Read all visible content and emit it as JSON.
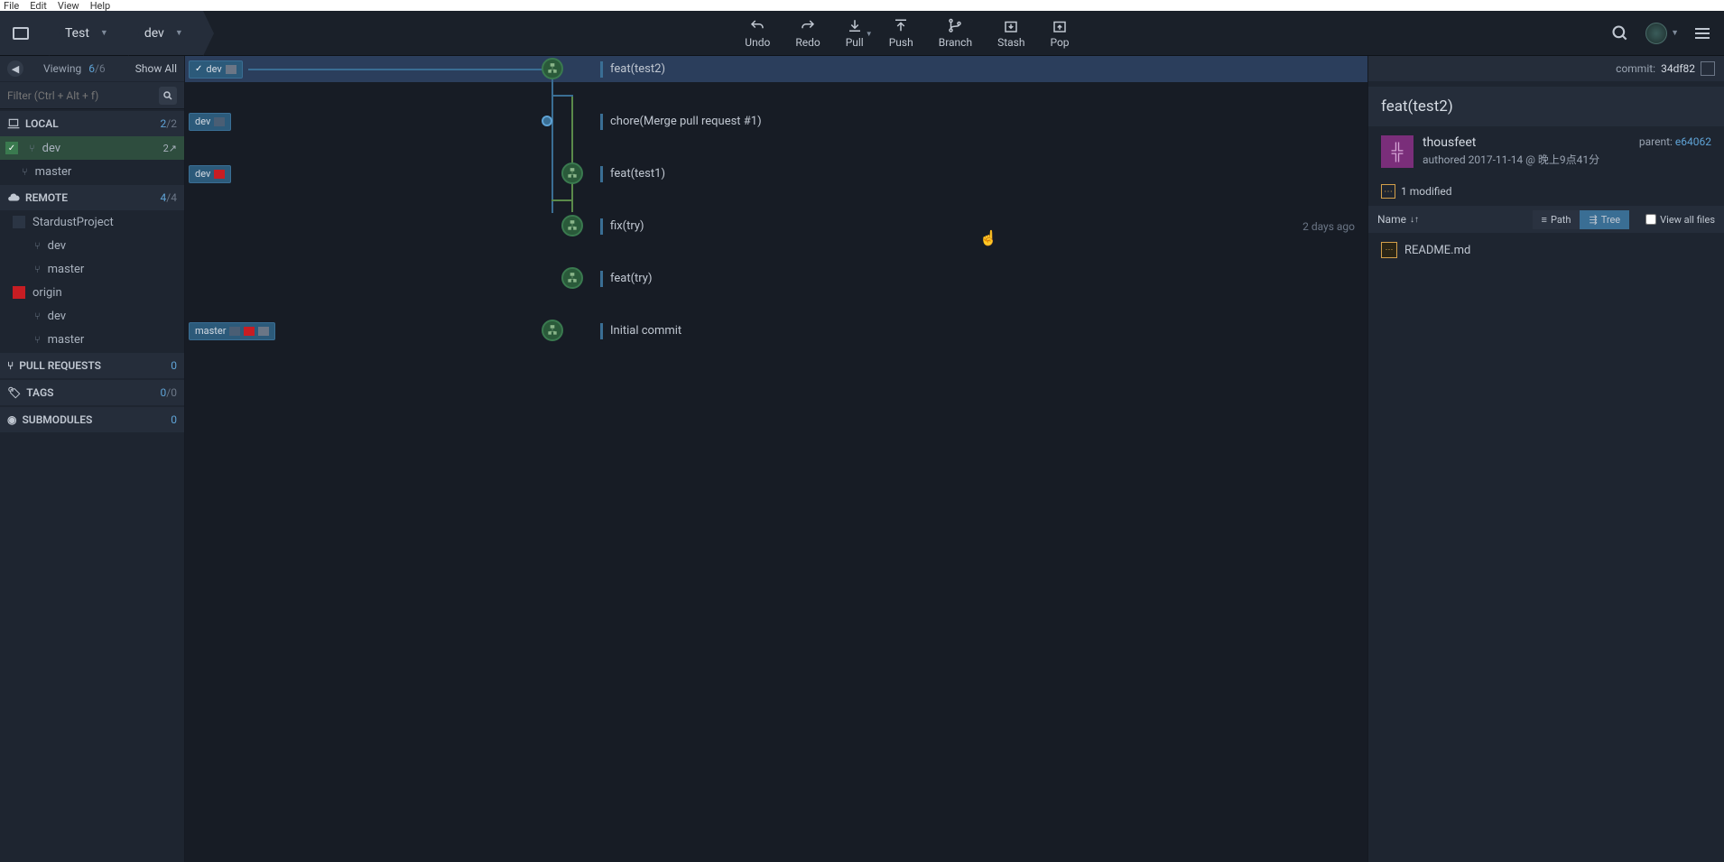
{
  "menubar": [
    "File",
    "Edit",
    "View",
    "Help"
  ],
  "breadcrumbs": {
    "repo": "Test",
    "branch": "dev"
  },
  "toolbar_buttons": [
    {
      "id": "undo",
      "label": "Undo"
    },
    {
      "id": "redo",
      "label": "Redo"
    },
    {
      "id": "pull",
      "label": "Pull",
      "caret": true
    },
    {
      "id": "push",
      "label": "Push"
    },
    {
      "id": "branch",
      "label": "Branch"
    },
    {
      "id": "stash",
      "label": "Stash"
    },
    {
      "id": "pop",
      "label": "Pop"
    }
  ],
  "sidebar": {
    "viewing_label": "Viewing",
    "viewing_count": "6",
    "viewing_total": "/6",
    "show_all": "Show All",
    "filter_placeholder": "Filter (Ctrl + Alt + f)",
    "sections": {
      "local": {
        "label": "LOCAL",
        "count": "2",
        "total": "/2",
        "items": [
          {
            "name": "dev",
            "active": true,
            "ahead": "2↗"
          },
          {
            "name": "master"
          }
        ]
      },
      "remote": {
        "label": "REMOTE",
        "count": "4",
        "total": "/4",
        "repos": [
          {
            "name": "StardustProject",
            "icon": "sp",
            "branches": [
              "dev",
              "master"
            ]
          },
          {
            "name": "origin",
            "icon": "gitee",
            "branches": [
              "dev",
              "master"
            ]
          }
        ]
      },
      "pull_requests": {
        "label": "PULL REQUESTS",
        "count": "0"
      },
      "tags": {
        "label": "TAGS",
        "count": "0",
        "total": "/0"
      },
      "submodules": {
        "label": "SUBMODULES",
        "count": "0"
      }
    }
  },
  "commits": [
    {
      "refs": [
        {
          "name": "dev",
          "current": true,
          "icons": [
            "laptop"
          ]
        }
      ],
      "msg": "feat(test2)",
      "selected": true,
      "lane": 0
    },
    {
      "refs": [
        {
          "name": "dev",
          "icons": [
            "sp"
          ]
        }
      ],
      "msg": "chore(Merge pull request #1)",
      "merge": true,
      "lane": 0
    },
    {
      "refs": [
        {
          "name": "dev",
          "icons": [
            "gitee"
          ]
        }
      ],
      "msg": "feat(test1)",
      "lane": 1
    },
    {
      "refs": [],
      "msg": "fix(try)",
      "time": "2 days ago",
      "lane": 1
    },
    {
      "refs": [],
      "msg": "feat(try)",
      "lane": 1
    },
    {
      "refs": [
        {
          "name": "master",
          "icons": [
            "sp",
            "gitee",
            "laptop"
          ]
        }
      ],
      "msg": "Initial commit",
      "lane": 0
    }
  ],
  "detail": {
    "commit_label": "commit:",
    "commit_hash": "34df82",
    "title": "feat(test2)",
    "author": "thousfeet",
    "authored_label": "authored",
    "authored_date": "2017-11-14 @ 晚上9点41分",
    "parent_label": "parent:",
    "parent_hash": "e64062",
    "modified_count": "1 modified",
    "sort_label": "Name",
    "path_label": "Path",
    "tree_label": "Tree",
    "view_all_label": "View all files",
    "files": [
      "README.md"
    ]
  }
}
